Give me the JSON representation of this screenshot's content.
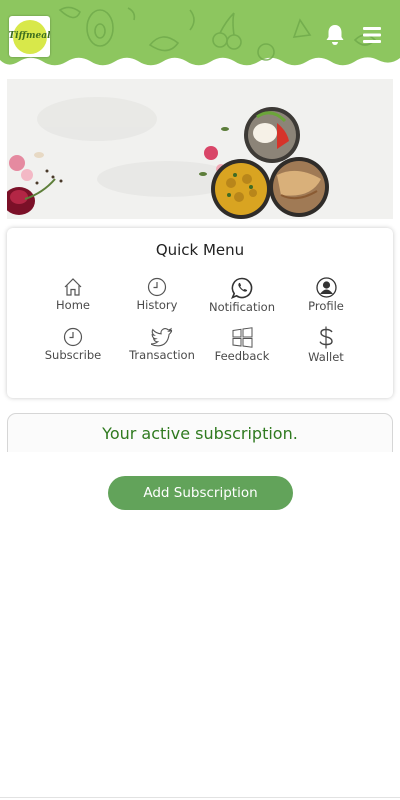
{
  "app": {
    "logo_text_1": "Tiffmeal",
    "logo_text_2": ""
  },
  "header": {
    "bell_icon": "bell-icon",
    "menu_icon": "hamburger-menu-icon",
    "color": "#8dc65f"
  },
  "banner": {
    "image": "food-banner"
  },
  "quick_menu": {
    "title": "Quick Menu",
    "items": [
      {
        "label": "Home",
        "icon": "home-icon"
      },
      {
        "label": "History",
        "icon": "clock-icon"
      },
      {
        "label": "Notification",
        "icon": "whatsapp-icon"
      },
      {
        "label": "Profile",
        "icon": "user-icon"
      },
      {
        "label": "Subscribe",
        "icon": "clock-icon"
      },
      {
        "label": "Transaction",
        "icon": "twitter-icon"
      },
      {
        "label": "Feedback",
        "icon": "windows-icon"
      },
      {
        "label": "Wallet",
        "icon": "dollar-icon"
      }
    ]
  },
  "subscription": {
    "active_text": "Your active subscription.",
    "add_button": "Add Subscription"
  }
}
